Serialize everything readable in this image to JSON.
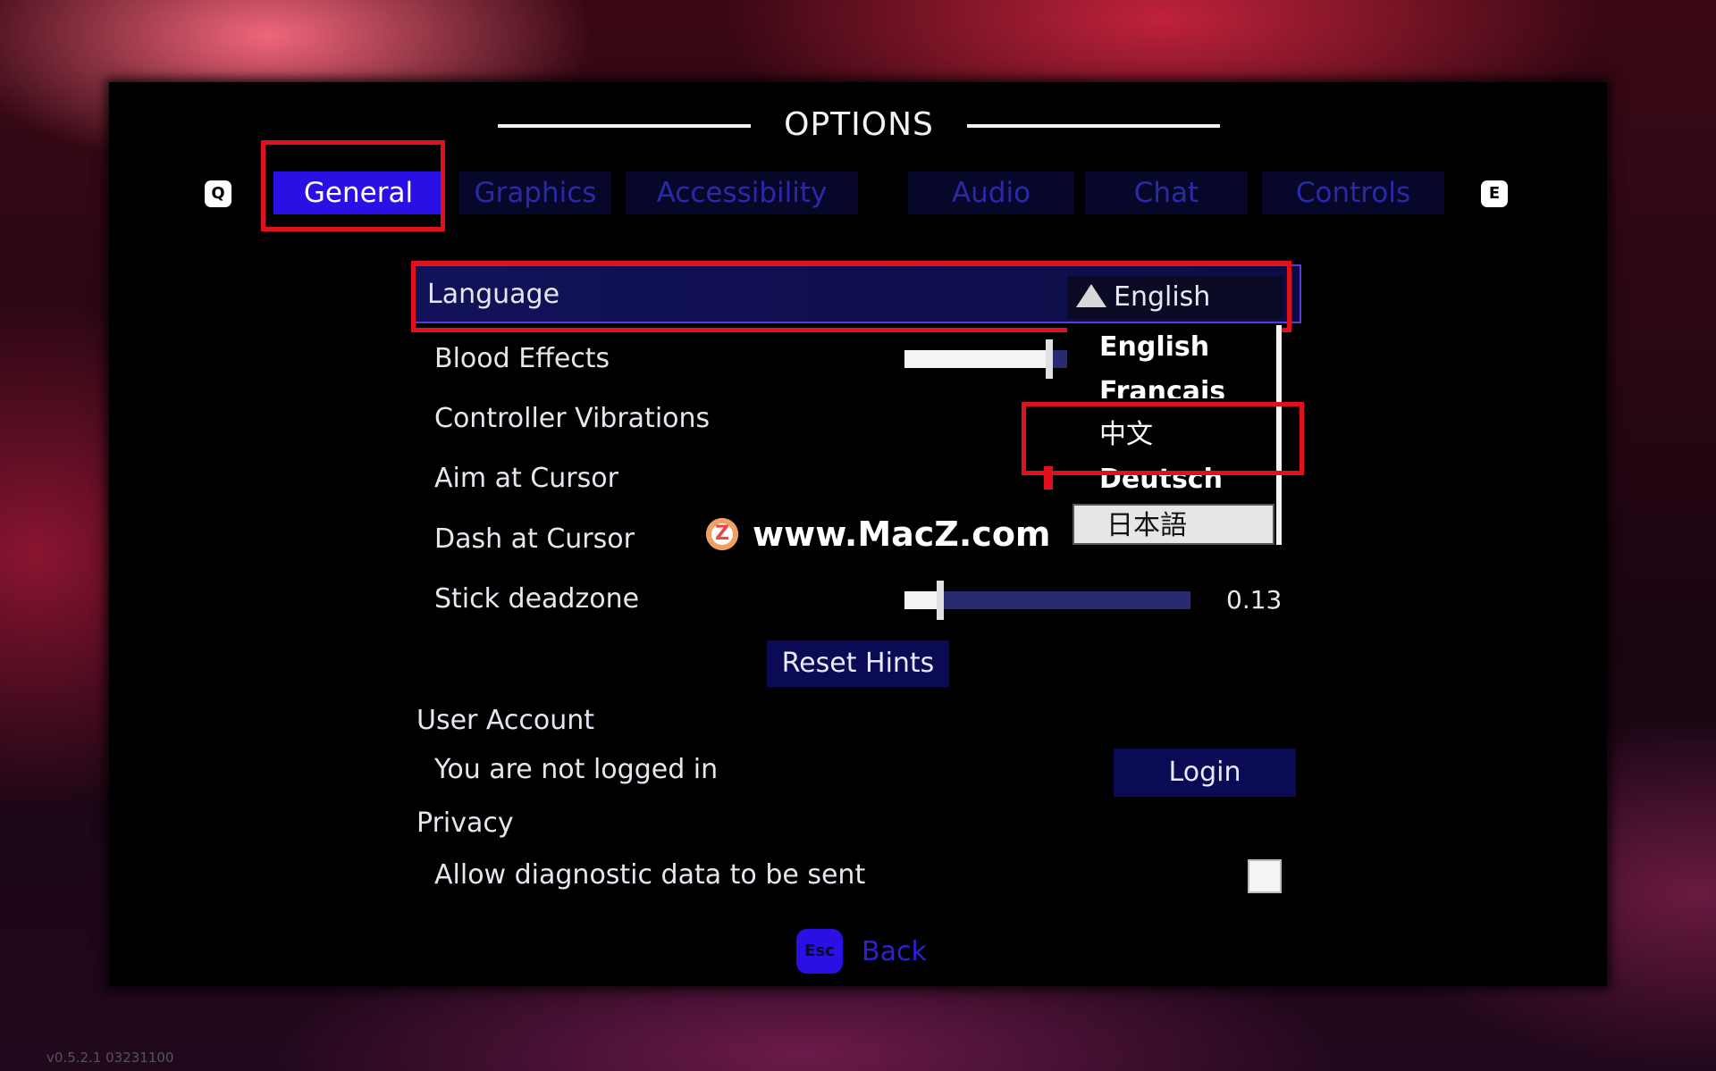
{
  "title": "OPTIONS",
  "keys": {
    "prev": "Q",
    "next": "E",
    "back": "Esc"
  },
  "tabs": [
    {
      "label": "General",
      "active": true
    },
    {
      "label": "Graphics",
      "active": false
    },
    {
      "label": "Accessibility",
      "active": false
    },
    {
      "label": "Audio",
      "active": false
    },
    {
      "label": "Chat",
      "active": false
    },
    {
      "label": "Controls",
      "active": false
    }
  ],
  "settings": {
    "language": {
      "label": "Language",
      "value": "English"
    },
    "blood_effects": {
      "label": "Blood Effects",
      "level": 0.55
    },
    "controller_vibrations": {
      "label": "Controller Vibrations"
    },
    "aim_at_cursor": {
      "label": "Aim at Cursor"
    },
    "dash_at_cursor": {
      "label": "Dash at Cursor"
    },
    "stick_deadzone": {
      "label": "Stick deadzone",
      "value": "0.13",
      "level": 0.13
    }
  },
  "language_dropdown": {
    "options": [
      "English",
      "Français",
      "中文",
      "Deutsch",
      "日本語"
    ],
    "highlighted": "日本語"
  },
  "reset_hints_label": "Reset Hints",
  "user_account": {
    "heading": "User Account",
    "status": "You are not logged in",
    "login_label": "Login"
  },
  "privacy": {
    "heading": "Privacy",
    "diagnostic_label": "Allow diagnostic data to be sent"
  },
  "back_label": "Back",
  "watermark": {
    "logo_letter": "Z",
    "text": "www.MacZ.com"
  },
  "version": "v0.5.2.1 03231100",
  "colors": {
    "accent": "#2b10e6",
    "highlight_box": "#e0101c",
    "panel": "#000000"
  }
}
